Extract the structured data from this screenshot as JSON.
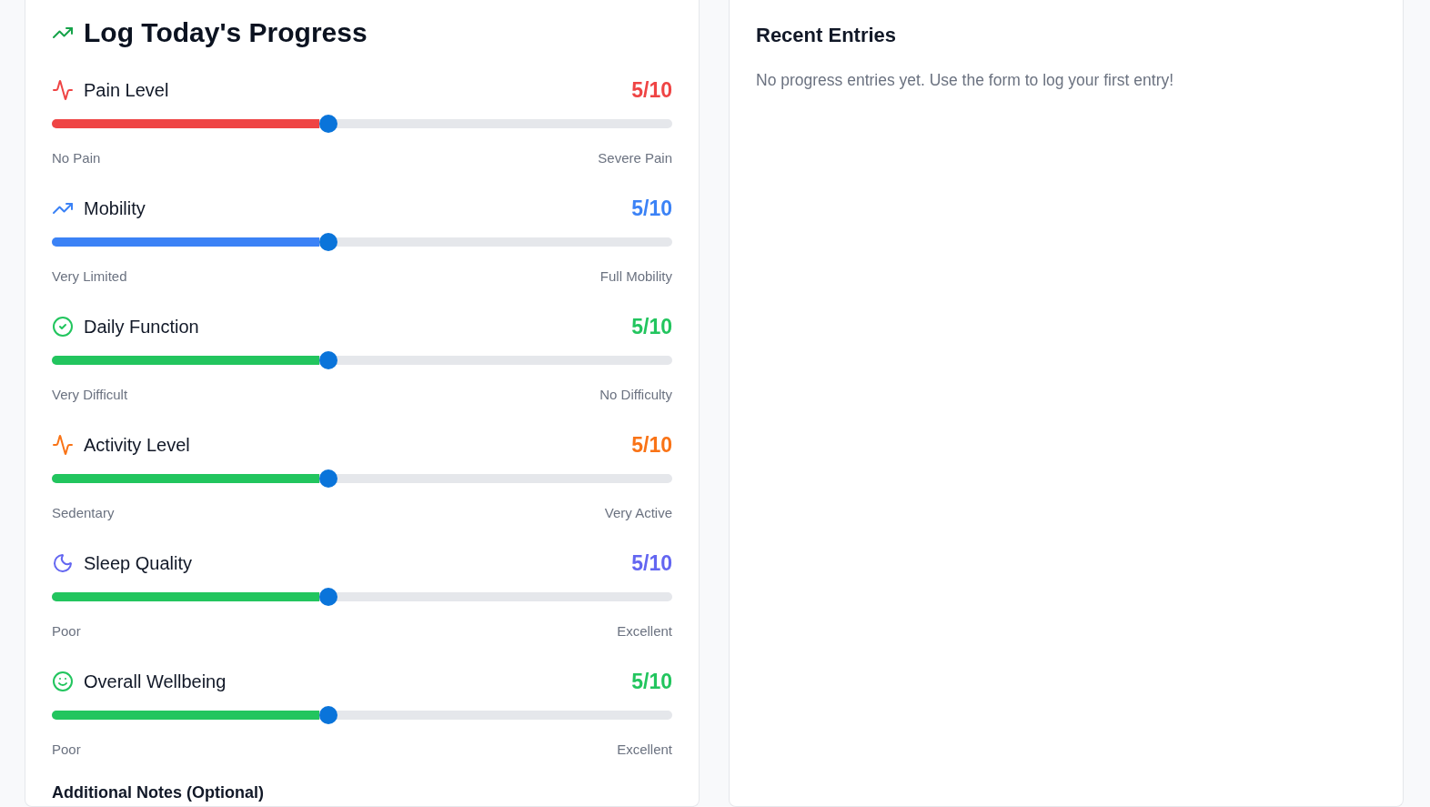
{
  "form": {
    "title": "Log Today's Progress",
    "metrics": [
      {
        "kind": "pain",
        "label": "Pain Level",
        "value": "5/10",
        "color": "#ef4444",
        "slider": {
          "level": 0.444,
          "color": "#ef4444"
        },
        "min_label": "No Pain",
        "max_label": "Severe Pain"
      },
      {
        "kind": "mobility",
        "label": "Mobility",
        "value": "5/10",
        "color": "#3b82f6",
        "slider": {
          "level": 0.444,
          "color": "#3b82f6"
        },
        "min_label": "Very Limited",
        "max_label": "Full Mobility"
      },
      {
        "kind": "function",
        "label": "Daily Function",
        "value": "5/10",
        "color": "#22c55e",
        "slider": {
          "level": 0.444,
          "color": "#22c55e"
        },
        "min_label": "Very Difficult",
        "max_label": "No Difficulty"
      },
      {
        "kind": "activity",
        "label": "Activity Level",
        "value": "5/10",
        "color": "#f97316",
        "slider": {
          "level": 0.444,
          "color": "#22c55e"
        },
        "min_label": "Sedentary",
        "max_label": "Very Active"
      },
      {
        "kind": "sleep",
        "label": "Sleep Quality",
        "value": "5/10",
        "color": "#6366f1",
        "slider": {
          "level": 0.444,
          "color": "#22c55e"
        },
        "min_label": "Poor",
        "max_label": "Excellent"
      },
      {
        "kind": "wellbeing",
        "label": "Overall Wellbeing",
        "value": "5/10",
        "color": "#22c55e",
        "slider": {
          "level": 0.444,
          "color": "#22c55e"
        },
        "min_label": "Poor",
        "max_label": "Excellent"
      }
    ],
    "notes_label": "Additional Notes (Optional)"
  },
  "recent_entries": {
    "title": "Recent Entries",
    "empty_message": "No progress entries yet. Use the form to log your first entry!"
  }
}
